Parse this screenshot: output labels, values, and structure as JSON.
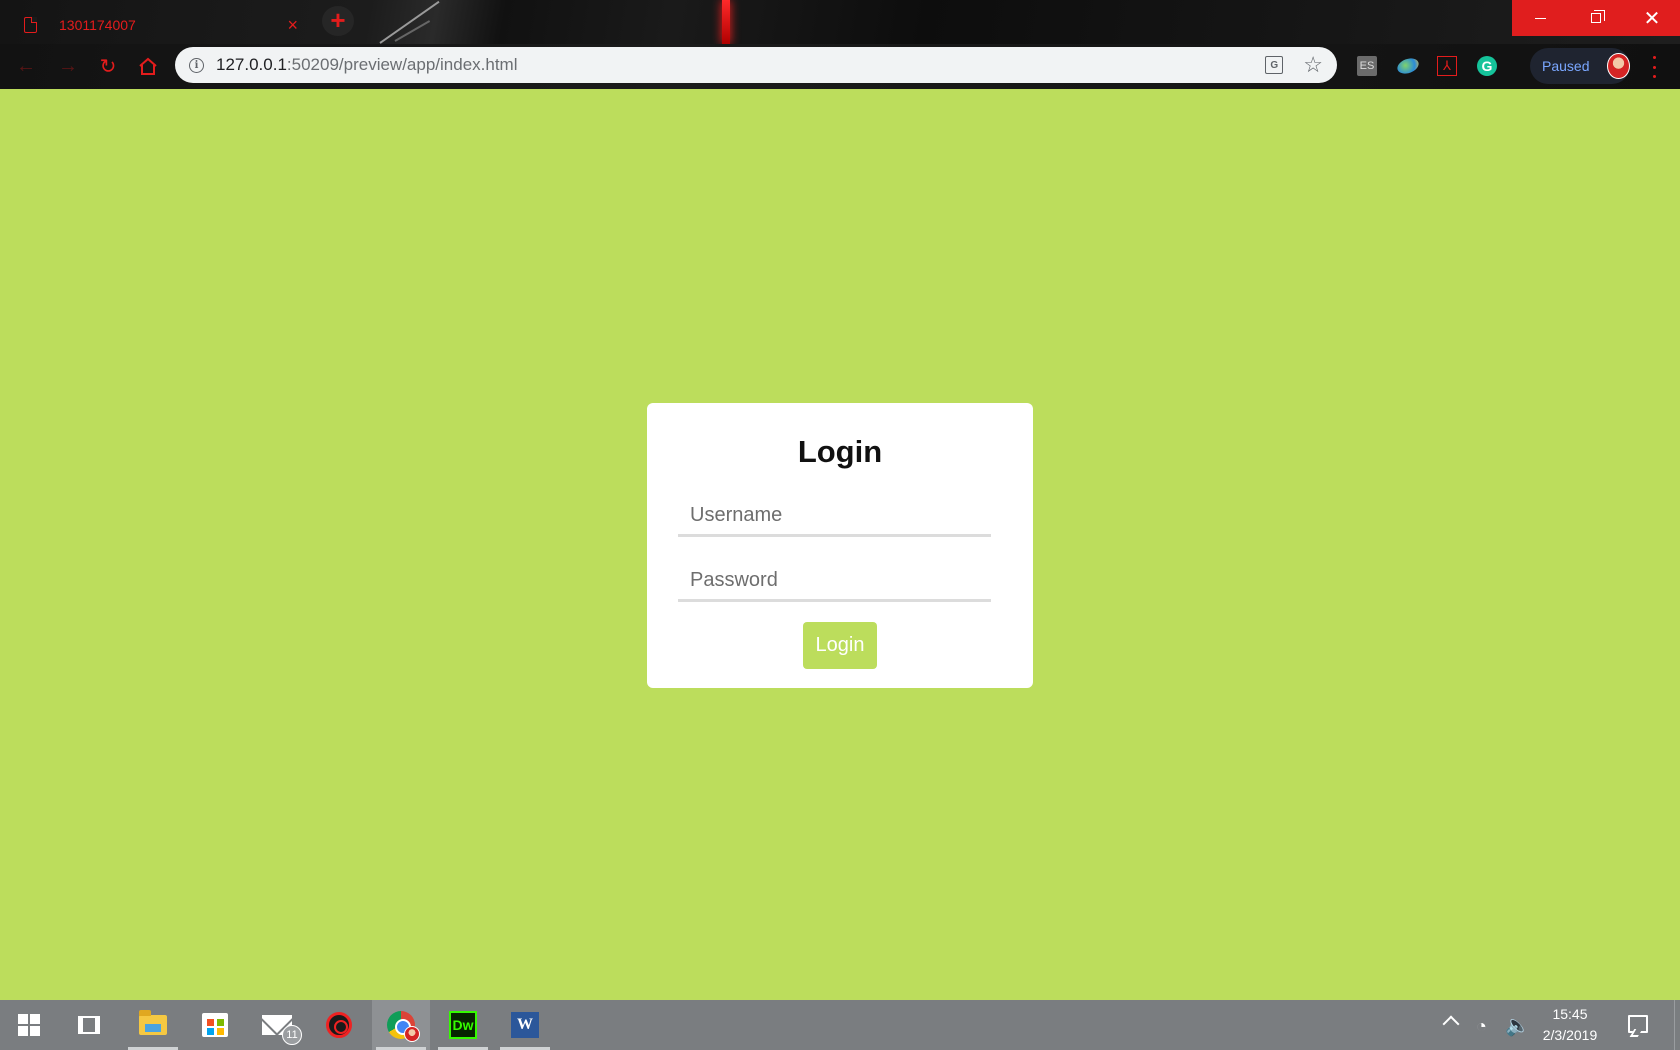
{
  "browser": {
    "tab_title": "1301174007",
    "tab_close": "×",
    "new_tab": "+",
    "url_host": "127.0.0.1",
    "url_rest": ":50209/preview/app/index.html",
    "profile_status": "Paused",
    "extensions": [
      {
        "name": "es-extension",
        "label": "ES"
      },
      {
        "name": "globe-extension",
        "label": ""
      },
      {
        "name": "pdf-extension",
        "label": "⅄"
      },
      {
        "name": "grammarly-extension",
        "label": "G"
      }
    ],
    "window_controls": {
      "minimize": "",
      "restore": "",
      "close": "✕"
    }
  },
  "login": {
    "title": "Login",
    "username_placeholder": "Username",
    "password_placeholder": "Password",
    "button_label": "Login"
  },
  "taskbar": {
    "mail_badge": "11",
    "dw_label": "Dw",
    "word_label": "W",
    "time": "15:45",
    "date": "2/3/2019"
  },
  "colors": {
    "page_background": "#bcdd5c",
    "accent": "#e31c1c",
    "button": "#bcdd5c"
  }
}
